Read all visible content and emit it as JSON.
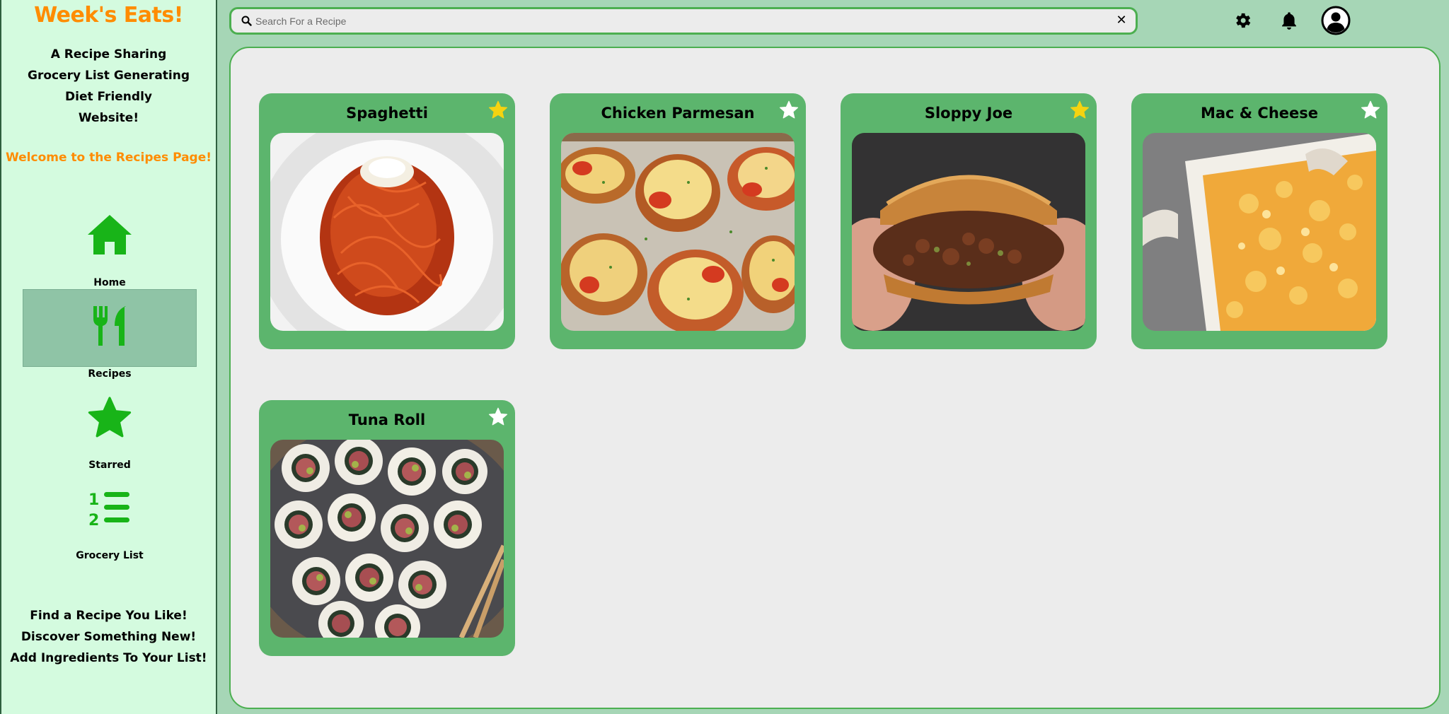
{
  "app": {
    "brand": "Week's Eats!",
    "tagline": [
      "A Recipe Sharing",
      "Grocery List Generating",
      "Diet Friendly",
      "Website!"
    ],
    "welcome": "Welcome to the Recipes Page!"
  },
  "nav": {
    "items": [
      {
        "label": "Home",
        "icon": "home-icon"
      },
      {
        "label": "Recipes",
        "icon": "utensils-icon",
        "active": true
      },
      {
        "label": "Starred",
        "icon": "star-icon"
      },
      {
        "label": "Grocery List",
        "icon": "list-ordered-icon"
      }
    ]
  },
  "footer": {
    "lines": [
      "Find a Recipe You Like!",
      "Discover Something New!",
      "Add Ingredients To Your List!"
    ]
  },
  "search": {
    "placeholder": "Search For a Recipe",
    "value": "",
    "clear_label": "✕"
  },
  "topbar": {
    "icons": [
      "gear-icon",
      "bell-icon",
      "user-circle-icon"
    ]
  },
  "recipes": [
    {
      "title": "Spaghetti",
      "starred": true
    },
    {
      "title": "Chicken Parmesan",
      "starred": false
    },
    {
      "title": "Sloppy Joe",
      "starred": true
    },
    {
      "title": "Mac & Cheese",
      "starred": false
    },
    {
      "title": "Tuna Roll",
      "starred": false
    }
  ],
  "colors": {
    "brand_orange": "#ff8c00",
    "accent_green": "#4caf50",
    "card_green": "#5cb56d",
    "icon_green": "#18b418",
    "star_gold": "#f5d311",
    "star_white": "#ffffff"
  }
}
